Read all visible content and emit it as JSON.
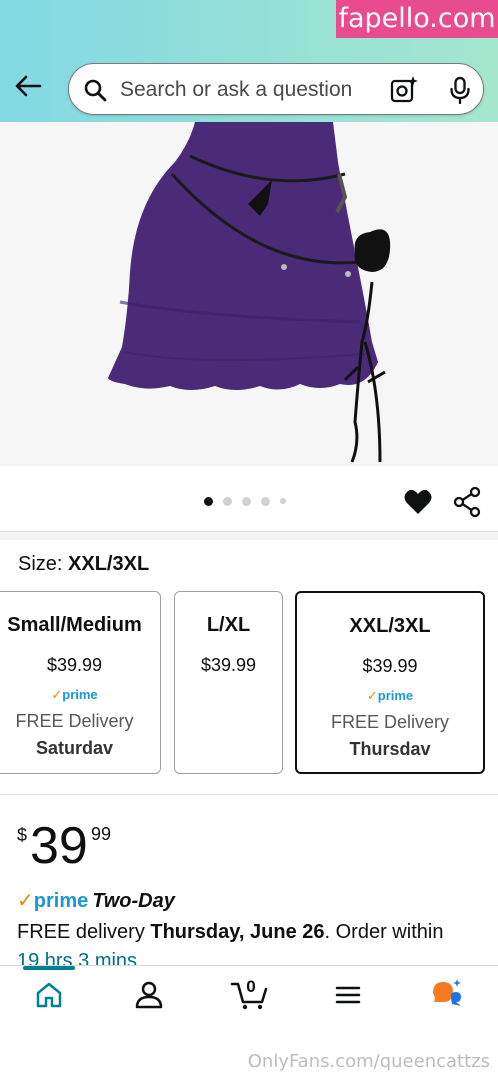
{
  "watermark_top": "fapello.com",
  "watermark_bottom": "OnlyFans.com/queencattzs",
  "search": {
    "placeholder": "Search or ask a question"
  },
  "icons": {
    "back": "arrow-left-icon",
    "search": "search-icon",
    "camera": "camera-lens-icon",
    "mic": "microphone-icon",
    "heart": "heart-icon",
    "share": "share-icon"
  },
  "gallery": {
    "total_dots": 5,
    "active_index": 0
  },
  "size_label": "Size:",
  "size_selected": "XXL/3XL",
  "size_options": [
    {
      "name": "Small/Medium",
      "price": "$39.99",
      "prime": true,
      "delivery": "FREE Delivery",
      "day": "Saturdav",
      "selected": false
    },
    {
      "name": "L/XL",
      "price": "$39.99",
      "prime": false,
      "delivery": "",
      "day": "",
      "selected": false
    },
    {
      "name": "XXL/3XL",
      "price": "$39.99",
      "prime": true,
      "delivery": "FREE Delivery",
      "day": "Thursdav",
      "selected": true
    }
  ],
  "prime_label": "prime",
  "price": {
    "currency": "$",
    "whole": "39",
    "fraction": "99"
  },
  "prime_line": {
    "word": "prime",
    "suffix": "Two-Day"
  },
  "delivery": {
    "prefix": "FREE delivery ",
    "date": "Thursday, June 26",
    "suffix": ". Order within"
  },
  "countdown": "19 hrs 3 mins",
  "bottom_nav": [
    {
      "name": "home",
      "icon": "home-icon",
      "active": true
    },
    {
      "name": "account",
      "icon": "person-icon",
      "active": false
    },
    {
      "name": "cart",
      "icon": "cart-icon",
      "badge": "0",
      "active": false
    },
    {
      "name": "menu",
      "icon": "menu-icon",
      "active": false
    },
    {
      "name": "rufus",
      "icon": "chat-bubble-icon",
      "active": false
    }
  ],
  "colors": {
    "header_gradient_start": "#82d8e3",
    "header_gradient_end": "#a6e6cf",
    "prime_blue": "#1a98d5",
    "prime_check": "#f08804",
    "link_teal": "#007185",
    "nav_active": "#008296",
    "watermark_pink": "#e94b8f",
    "skirt_purple": "#4b2a78"
  }
}
